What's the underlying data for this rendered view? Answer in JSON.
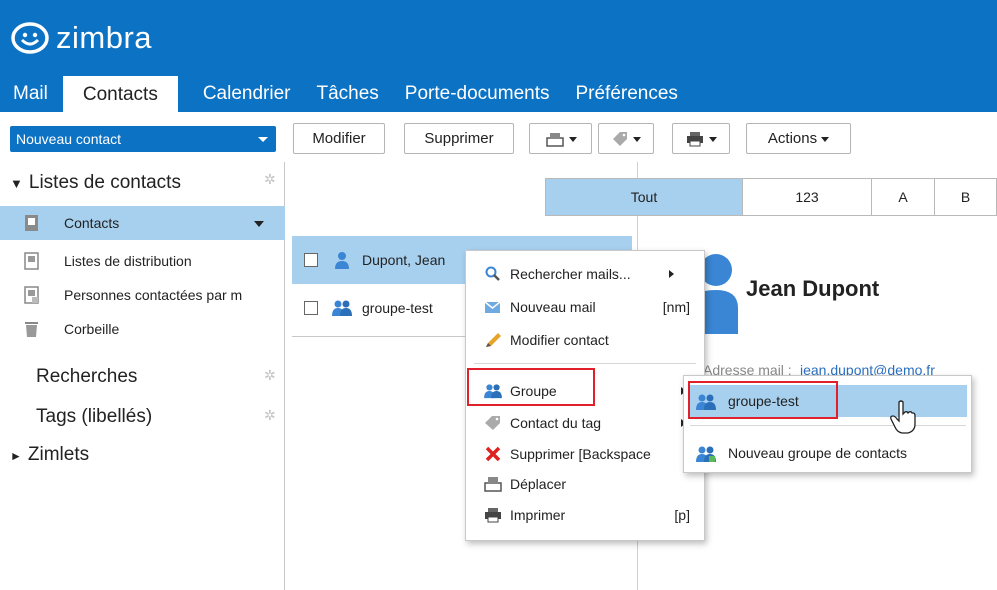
{
  "app": {
    "logo_text": "zimbra",
    "brand_color": "#0c72c4",
    "selected_color": "#a7d0ef",
    "highlight_color": "#e0202a"
  },
  "tabs": [
    {
      "label": "Mail",
      "active": false
    },
    {
      "label": "Contacts",
      "active": true
    },
    {
      "label": "Calendrier",
      "active": false
    },
    {
      "label": "Tâches",
      "active": false
    },
    {
      "label": "Porte-documents",
      "active": false
    },
    {
      "label": "Préférences",
      "active": false
    }
  ],
  "toolbar": {
    "new_contact": "Nouveau contact",
    "modify": "Modifier",
    "delete": "Supprimer",
    "actions": "Actions",
    "icon_buttons": [
      "move-icon",
      "tag-icon",
      "print-icon"
    ]
  },
  "sidebar": {
    "contact_lists_header": "Listes de contacts",
    "items": [
      {
        "label": "Contacts",
        "icon": "address-book-icon",
        "selected": true
      },
      {
        "label": "Listes de distribution",
        "icon": "distribution-list-icon",
        "selected": false
      },
      {
        "label": "Personnes contactées par m",
        "icon": "emailed-contacts-icon",
        "selected": false
      },
      {
        "label": "Corbeille",
        "icon": "trash-icon",
        "selected": false
      }
    ],
    "searches_header": "Recherches",
    "tags_header": "Tags (libellés)",
    "zimlets_header": "Zimlets"
  },
  "alpha_bar": [
    "Tout",
    "123",
    "A",
    "B"
  ],
  "contacts": [
    {
      "name": "Dupont, Jean",
      "icon": "person-icon",
      "selected": true
    },
    {
      "name": "groupe-test",
      "icon": "group-icon",
      "selected": false
    }
  ],
  "detail": {
    "name": "Jean Dupont",
    "email_label": "Adresse mail :",
    "email": "jean.dupont@demo.fr"
  },
  "context_menu": [
    {
      "label": "Rechercher mails...",
      "icon": "search-icon",
      "shortcut": "",
      "submenu": true
    },
    {
      "label": "Nouveau mail",
      "icon": "new-mail-icon",
      "shortcut": "[nm]",
      "submenu": false
    },
    {
      "label": "Modifier contact",
      "icon": "edit-pencil-icon",
      "shortcut": "",
      "submenu": false
    },
    {
      "label": "Groupe",
      "icon": "group-icon",
      "shortcut": "",
      "submenu": true
    },
    {
      "label": "Contact du tag",
      "icon": "tag-icon",
      "shortcut": "",
      "submenu": true
    },
    {
      "label": "Supprimer [Backspace",
      "icon": "delete-x-icon",
      "shortcut": "",
      "submenu": false
    },
    {
      "label": "Déplacer",
      "icon": "move-icon",
      "shortcut": "",
      "submenu": false
    },
    {
      "label": "Imprimer",
      "icon": "print-icon",
      "shortcut": "[p]",
      "submenu": false
    }
  ],
  "submenu": [
    {
      "label": "groupe-test",
      "icon": "group-icon",
      "hover": true
    },
    {
      "label": "Nouveau groupe de contacts",
      "icon": "new-group-icon",
      "hover": false
    }
  ]
}
